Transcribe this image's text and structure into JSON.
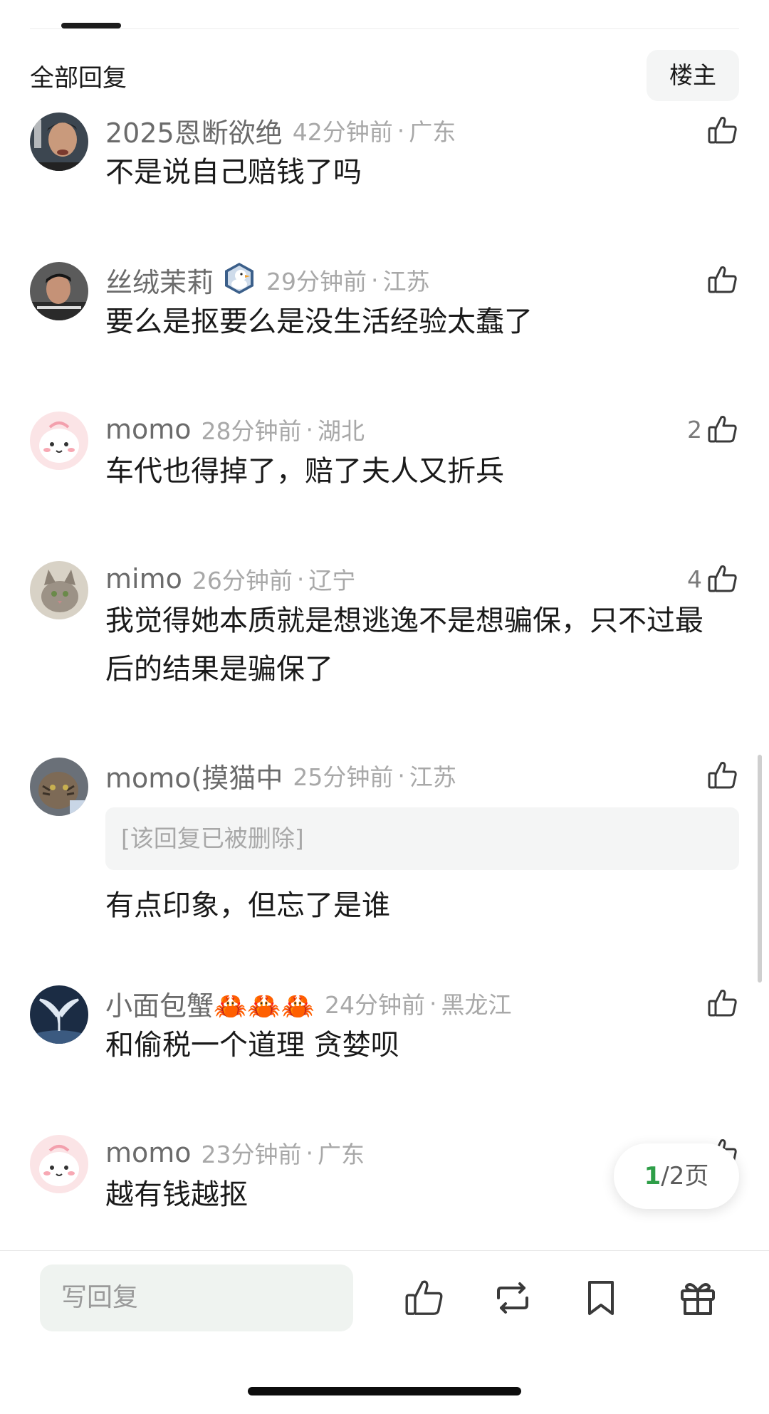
{
  "header": {
    "section_title": "全部回复",
    "op_button": "楼主"
  },
  "comments": [
    {
      "username": "2025恩断欲绝",
      "time": "42分钟前",
      "location": "广东",
      "text": "不是说自己赔钱了吗",
      "likes": "",
      "avatar": "person-photo-avatar"
    },
    {
      "username": "丝绒茉莉",
      "time": "29分钟前",
      "location": "江苏",
      "text": "要么是抠要么是没生活经验太蠢了",
      "likes": "",
      "avatar": "person-photo-avatar",
      "badge": "duck-badge-icon"
    },
    {
      "username": "momo",
      "time": "28分钟前",
      "location": "湖北",
      "text": "车代也得掉了，赔了夫人又折兵",
      "likes": "2",
      "avatar": "pink-cartoon-avatar"
    },
    {
      "username": "mimo",
      "time": "26分钟前",
      "location": "辽宁",
      "text": "我觉得她本质就是想逃逸不是想骗保，只不过最后的结果是骗保了",
      "likes": "4",
      "avatar": "cat-photo-avatar"
    },
    {
      "username": "momo(摸猫中",
      "time": "25分钟前",
      "location": "江苏",
      "quoted": "[该回复已被删除]",
      "text": "有点印象，但忘了是谁",
      "likes": "",
      "avatar": "cat-photo-avatar"
    },
    {
      "username": "小面包蟹🦀🦀🦀",
      "time": "24分钟前",
      "location": "黑龙江",
      "text": "和偷税一个道理 贪婪呗",
      "likes": "",
      "avatar": "whale-tail-avatar"
    },
    {
      "username": "momo",
      "time": "23分钟前",
      "location": "广东",
      "text": "越有钱越抠",
      "likes": "",
      "avatar": "pink-cartoon-avatar"
    }
  ],
  "pager": {
    "current": "1",
    "rest": "/2页"
  },
  "bottom_bar": {
    "reply_placeholder": "写回复",
    "actions": [
      "like-icon",
      "repost-icon",
      "bookmark-icon",
      "gift-icon"
    ]
  },
  "colors": {
    "accent_green": "#2e9e48",
    "meta_gray": "#a8a8a8"
  }
}
